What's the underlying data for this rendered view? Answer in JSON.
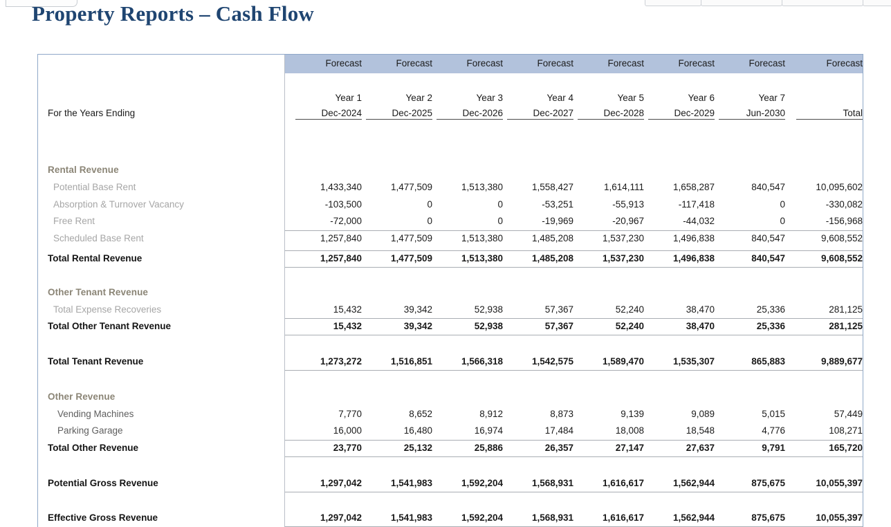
{
  "window": {
    "tab_stub": "",
    "toolbar_segments": 4
  },
  "report": {
    "title": "Property Reports – Cash Flow",
    "title_color": "#1f4571",
    "header_band_color": "#b2c2dc",
    "row_label_header": "For the Years Ending",
    "column_type_label": "Forecast",
    "columns": [
      {
        "type": "Forecast",
        "year": "Year 1",
        "period": "Dec-2024"
      },
      {
        "type": "Forecast",
        "year": "Year 2",
        "period": "Dec-2025"
      },
      {
        "type": "Forecast",
        "year": "Year 3",
        "period": "Dec-2026"
      },
      {
        "type": "Forecast",
        "year": "Year 4",
        "period": "Dec-2027"
      },
      {
        "type": "Forecast",
        "year": "Year 5",
        "period": "Dec-2028"
      },
      {
        "type": "Forecast",
        "year": "Year 6",
        "period": "Dec-2029"
      },
      {
        "type": "Forecast",
        "year": "Year 7",
        "period": "Jun-2030"
      },
      {
        "type": "Forecast",
        "year": "",
        "period": "Total"
      }
    ],
    "rows": [
      {
        "label": "Rental Revenue",
        "style": "section",
        "values": []
      },
      {
        "label": "Potential Base Rent",
        "style": "sub",
        "values": [
          "1,433,340",
          "1,477,509",
          "1,513,380",
          "1,558,427",
          "1,614,111",
          "1,658,287",
          "840,547",
          "10,095,602"
        ]
      },
      {
        "label": "Absorption & Turnover Vacancy",
        "style": "sub",
        "values": [
          "-103,500",
          "0",
          "0",
          "-53,251",
          "-55,913",
          "-117,418",
          "0",
          "-330,082"
        ]
      },
      {
        "label": "Free Rent",
        "style": "sub",
        "values": [
          "-72,000",
          "0",
          "0",
          "-19,969",
          "-20,967",
          "-44,032",
          "0",
          "-156,968"
        ]
      },
      {
        "label": "Scheduled Base Rent",
        "style": "sub",
        "rule": "top",
        "values": [
          "1,257,840",
          "1,477,509",
          "1,513,380",
          "1,485,208",
          "1,537,230",
          "1,496,838",
          "840,547",
          "9,608,552"
        ]
      },
      {
        "label": "Total Rental Revenue",
        "style": "total",
        "rule": "both",
        "values": [
          "1,257,840",
          "1,477,509",
          "1,513,380",
          "1,485,208",
          "1,537,230",
          "1,496,838",
          "840,547",
          "9,608,552"
        ]
      },
      {
        "label": "Other Tenant Revenue",
        "style": "section",
        "values": []
      },
      {
        "label": "Total Expense Recoveries",
        "style": "sub",
        "values": [
          "15,432",
          "39,342",
          "52,938",
          "57,367",
          "52,240",
          "38,470",
          "25,336",
          "281,125"
        ]
      },
      {
        "label": "Total Other Tenant Revenue",
        "style": "total",
        "rule": "both",
        "values": [
          "15,432",
          "39,342",
          "52,938",
          "57,367",
          "52,240",
          "38,470",
          "25,336",
          "281,125"
        ]
      },
      {
        "label": "Total Tenant Revenue",
        "style": "total",
        "rule": "bottom",
        "values": [
          "1,273,272",
          "1,516,851",
          "1,566,318",
          "1,542,575",
          "1,589,470",
          "1,535,307",
          "865,883",
          "9,889,677"
        ]
      },
      {
        "label": "Other Revenue",
        "style": "section",
        "values": []
      },
      {
        "label": "Vending Machines",
        "style": "sub2",
        "values": [
          "7,770",
          "8,652",
          "8,912",
          "8,873",
          "9,139",
          "9,089",
          "5,015",
          "57,449"
        ]
      },
      {
        "label": "Parking Garage",
        "style": "sub2",
        "values": [
          "16,000",
          "16,480",
          "16,974",
          "17,484",
          "18,008",
          "18,548",
          "4,776",
          "108,271"
        ]
      },
      {
        "label": "Total Other Revenue",
        "style": "total",
        "rule": "both",
        "values": [
          "23,770",
          "25,132",
          "25,886",
          "26,357",
          "27,147",
          "27,637",
          "9,791",
          "165,720"
        ]
      },
      {
        "label": "Potential Gross Revenue",
        "style": "total",
        "rule": "bottom",
        "values": [
          "1,297,042",
          "1,541,983",
          "1,592,204",
          "1,568,931",
          "1,616,617",
          "1,562,944",
          "875,675",
          "10,055,397"
        ]
      },
      {
        "label": "Effective Gross Revenue",
        "style": "total",
        "rule": "bottom",
        "values": [
          "1,297,042",
          "1,541,983",
          "1,592,204",
          "1,568,931",
          "1,616,617",
          "1,562,944",
          "875,675",
          "10,055,397"
        ]
      }
    ]
  }
}
